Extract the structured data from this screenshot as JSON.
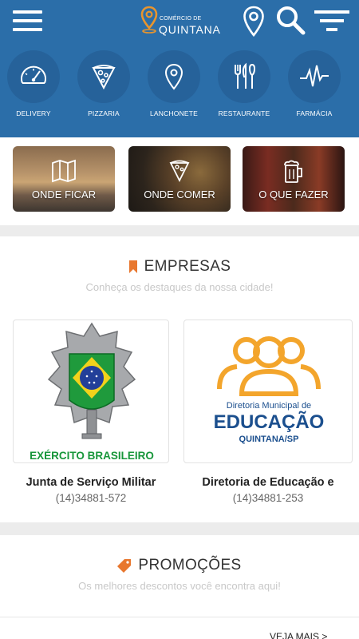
{
  "header": {
    "logo_small": "COMÉRCIO DE",
    "logo_big": "QUINTANA",
    "icons": {
      "menu": "hamburger-menu-icon",
      "location": "map-pin-icon",
      "search": "search-icon",
      "filter": "filter-icon"
    }
  },
  "categories": [
    {
      "label": "DELIVERY",
      "icon": "speedometer-icon"
    },
    {
      "label": "PIZZARIA",
      "icon": "pizza-icon"
    },
    {
      "label": "LANCHONETE",
      "icon": "map-pin-icon"
    },
    {
      "label": "RESTAURANTE",
      "icon": "cutlery-icon"
    },
    {
      "label": "FARMÁCIA",
      "icon": "heartbeat-icon"
    }
  ],
  "quick_links": [
    {
      "label": "ONDE FICAR",
      "icon": "map-icon"
    },
    {
      "label": "ONDE COMER",
      "icon": "pizza-slice-icon"
    },
    {
      "label": "O QUE FAZER",
      "icon": "beer-mug-icon"
    }
  ],
  "empresas": {
    "title": "EMPRESAS",
    "subtitle": "Conheça os destaques da nossa cidade!",
    "items": [
      {
        "name": "Junta de Serviço Militar",
        "phone": "(14)34881-572",
        "logo_text": "EXÉRCITO BRASILEIRO"
      },
      {
        "name": "Diretoria de Educação e",
        "phone": "(14)34881-253",
        "logo_line1": "Diretoria Municipal de",
        "logo_line2": "EDUCAÇÃO",
        "logo_line3": "QUINTANA/SP"
      }
    ]
  },
  "promocoes": {
    "title": "PROMOÇÕES",
    "subtitle": "Os melhores descontos você encontra aqui!",
    "more_label": "VEJA MAIS >"
  },
  "colors": {
    "header": "#2b6ea9",
    "accent": "#e8772e",
    "circle": "#26629a"
  }
}
